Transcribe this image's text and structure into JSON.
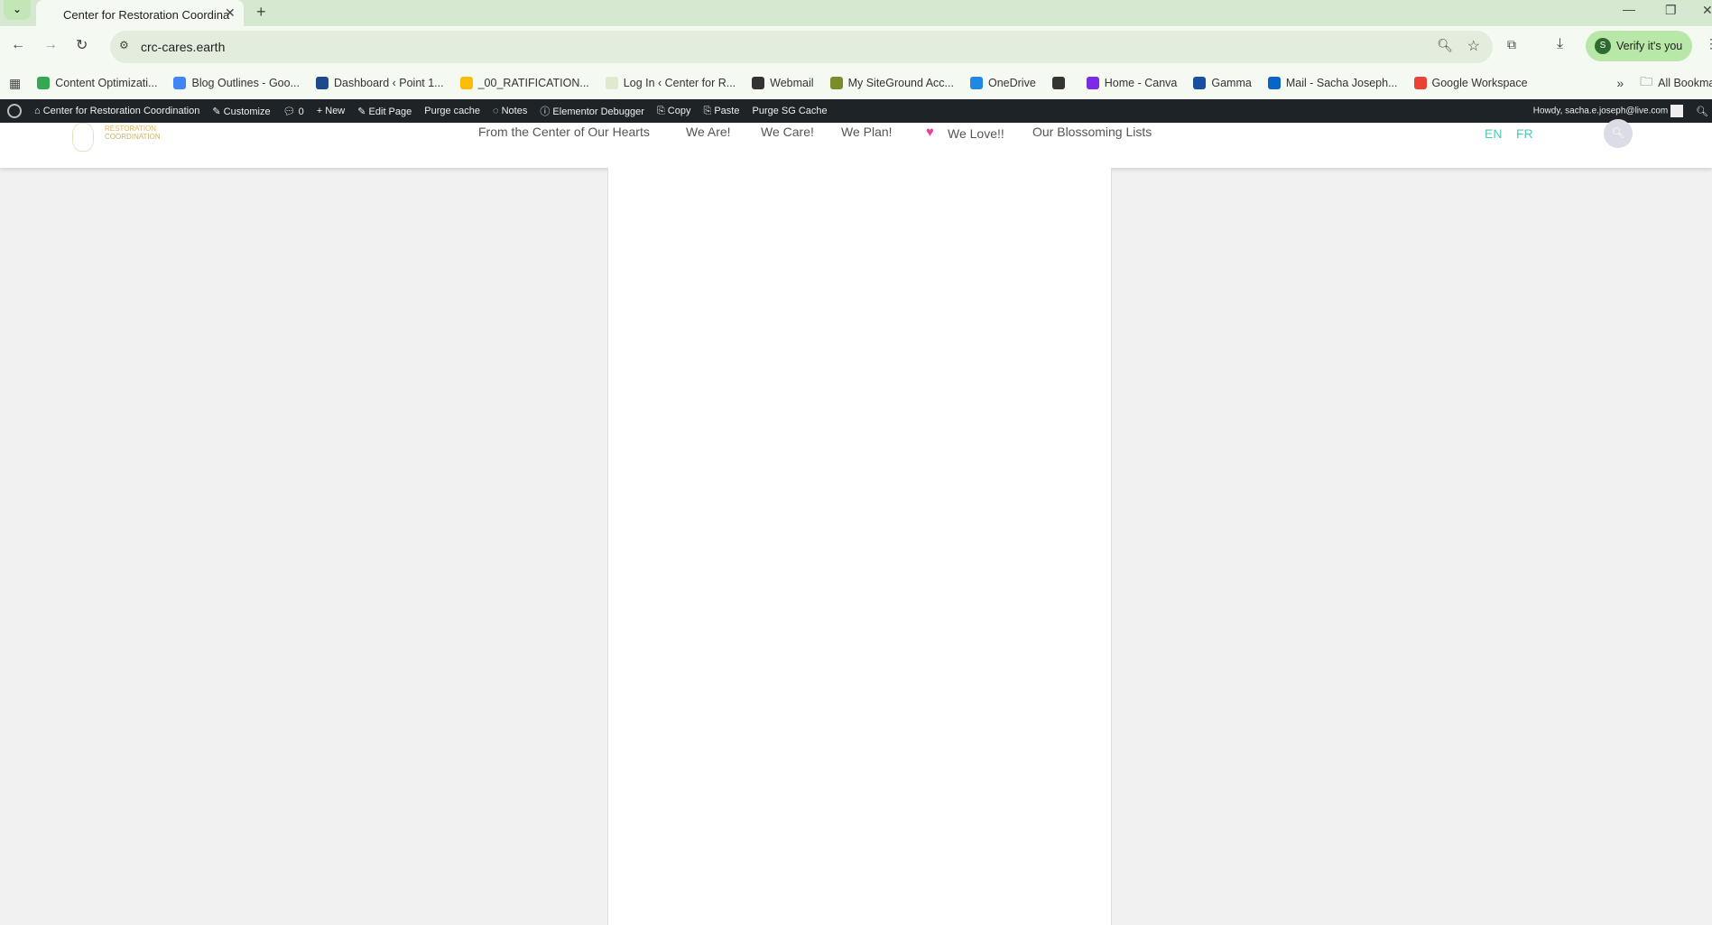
{
  "browser": {
    "tab_title": "Center for Restoration Coordina",
    "url": "crc-cares.earth",
    "verify_label": "Verify it's you",
    "profile_initial": "S"
  },
  "bookmarks": [
    {
      "label": "Content Optimizati...",
      "color": "#34a853"
    },
    {
      "label": "Blog Outlines - Goo...",
      "color": "#4285f4"
    },
    {
      "label": "Dashboard ‹ Point 1...",
      "color": "#1e4a8c"
    },
    {
      "label": "_00_RATIFICATION...",
      "color": "#fbbc04"
    },
    {
      "label": "Log In ‹ Center for R...",
      "color": "#e0e8d0"
    },
    {
      "label": "Webmail",
      "color": "#333"
    },
    {
      "label": "My SiteGround Acc...",
      "color": "#7a8c2a"
    },
    {
      "label": "OneDrive",
      "color": "#1e88e5"
    },
    {
      "label": "",
      "color": "#333"
    },
    {
      "label": "Home - Canva",
      "color": "#7d2ae8"
    },
    {
      "label": "Gamma",
      "color": "#1a4fa0"
    },
    {
      "label": "Mail - Sacha Joseph...",
      "color": "#0a64c8"
    },
    {
      "label": "Google Workspace",
      "color": "#ea4335"
    }
  ],
  "all_bookmarks": "All Bookmarks",
  "adminbar": {
    "site": "Center for Restoration Coordination",
    "customize": "Customize",
    "comments": "0",
    "new": "New",
    "edit_page": "Edit Page",
    "purge_cache": "Purge cache",
    "notes": "Notes",
    "elementor": "Elementor Debugger",
    "copy": "Copy",
    "paste": "Paste",
    "purge_sg": "Purge SG Cache",
    "howdy": "Howdy, sacha.e.joseph@live.com"
  },
  "site": {
    "logo_line1": "RESTORATION",
    "logo_line2": "COORDINATION",
    "nav": [
      "From the Center of Our Hearts",
      "We Are!",
      "We Care!",
      "We Plan!",
      "We Love!!",
      "Our Blossoming Lists"
    ],
    "lang": [
      "EN",
      "FR"
    ],
    "accent": "#4fc9b8",
    "heart": "#ee3fa3"
  }
}
